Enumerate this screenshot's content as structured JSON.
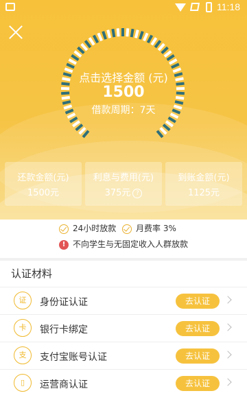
{
  "status_bar": {
    "time": "11:18"
  },
  "gauge": {
    "title": "点击选择金额 (元)",
    "amount": "1500",
    "period": "借款周期：7天"
  },
  "stats": [
    {
      "label": "还款金额(元)",
      "value": "1500元"
    },
    {
      "label": "利息与费用(元)",
      "value": "375元"
    },
    {
      "label": "到账金额(元)",
      "value": "1125元"
    }
  ],
  "features": {
    "item1": "24小时放款",
    "item2": "月费率 3%",
    "warning": "不向学生与无固定收入人群放款"
  },
  "section": {
    "title": "认证材料"
  },
  "verifications": [
    {
      "label": "身份证认证",
      "button": "去认证",
      "icon": "id-card-icon",
      "glyph": "证"
    },
    {
      "label": "银行卡绑定",
      "button": "去认证",
      "icon": "bank-card-icon",
      "glyph": "卡"
    },
    {
      "label": "支付宝账号认证",
      "button": "去认证",
      "icon": "alipay-icon",
      "glyph": "支"
    },
    {
      "label": "运营商认证",
      "button": "去认证",
      "icon": "phone-icon",
      "glyph": "▯"
    }
  ],
  "colors": {
    "brand": "#f6c23e",
    "gauge_ticks": "#2f6f7a",
    "warning": "#e25555"
  }
}
